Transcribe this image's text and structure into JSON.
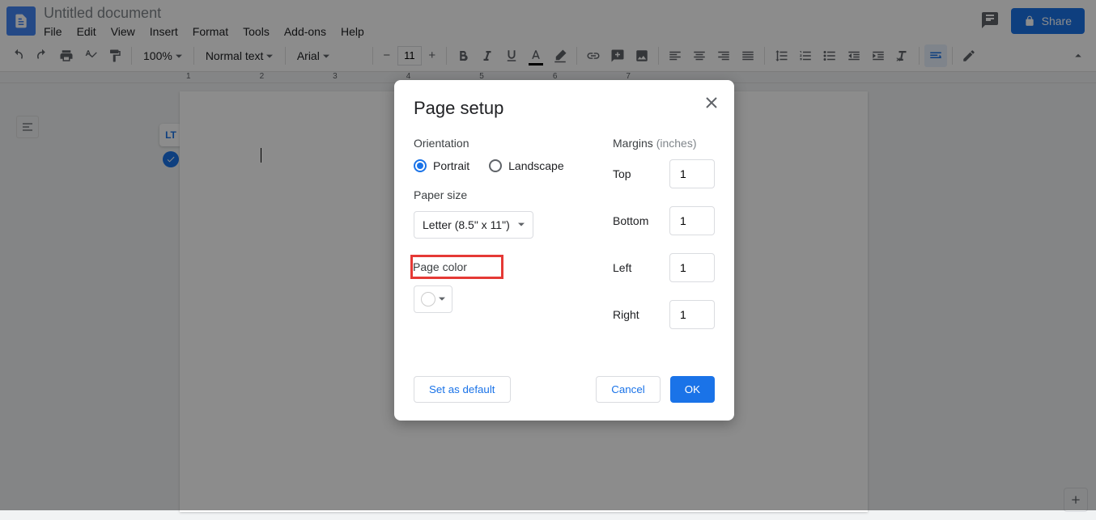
{
  "header": {
    "doc_title": "Untitled document",
    "menus": [
      "File",
      "Edit",
      "View",
      "Insert",
      "Format",
      "Tools",
      "Add-ons",
      "Help"
    ],
    "share_label": "Share"
  },
  "toolbar": {
    "zoom": "100%",
    "style": "Normal text",
    "font": "Arial",
    "font_size": "11"
  },
  "ruler": {
    "marks": [
      "1",
      "2",
      "3",
      "4",
      "5",
      "6",
      "7"
    ]
  },
  "dialog": {
    "title": "Page setup",
    "orientation_label": "Orientation",
    "portrait": "Portrait",
    "landscape": "Landscape",
    "paper_size_label": "Paper size",
    "paper_size_value": "Letter (8.5\" x 11\")",
    "page_color_label": "Page color",
    "margins_label": "Margins",
    "margins_unit": "(inches)",
    "top_label": "Top",
    "top_value": "1",
    "bottom_label": "Bottom",
    "bottom_value": "1",
    "left_label": "Left",
    "left_value": "1",
    "right_label": "Right",
    "right_value": "1",
    "set_default": "Set as default",
    "cancel": "Cancel",
    "ok": "OK"
  }
}
